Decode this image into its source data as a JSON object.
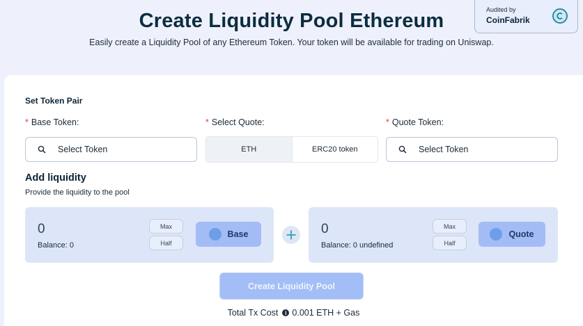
{
  "header": {
    "title": "Create Liquidity Pool Ethereum",
    "subtitle": "Easily create a Liquidity Pool of any Ethereum Token. Your token will be available for trading on Uniswap."
  },
  "audit": {
    "audited_by": "Audited by",
    "brand": "CoinFabrik",
    "logo_icon": "coinfabrik-logo-icon"
  },
  "token_pair": {
    "title": "Set Token Pair",
    "base_label": "Base Token:",
    "quote_select_label": "Select Quote:",
    "quote_label": "Quote Token:",
    "required_mark": "*",
    "base_placeholder": "Select Token",
    "quote_placeholder": "Select Token",
    "quote_options": [
      "ETH",
      "ERC20 token"
    ]
  },
  "liquidity": {
    "title": "Add liquidity",
    "description": "Provide the liquidity to the pool",
    "base": {
      "amount": "0",
      "balance": "Balance: 0",
      "max": "Max",
      "half": "Half",
      "token": "Base"
    },
    "quote": {
      "amount": "0",
      "balance": "Balance: 0 undefined",
      "max": "Max",
      "half": "Half",
      "token": "Quote"
    }
  },
  "actions": {
    "create_label": "Create Liquidity Pool",
    "tx_cost_label": "Total Tx Cost",
    "tx_cost_value": "0.001 ETH + Gas"
  },
  "colors": {
    "accent": "#a3bcf5",
    "title": "#0b2d3f",
    "required": "#e03b3b",
    "panel": "#dde6f8"
  }
}
